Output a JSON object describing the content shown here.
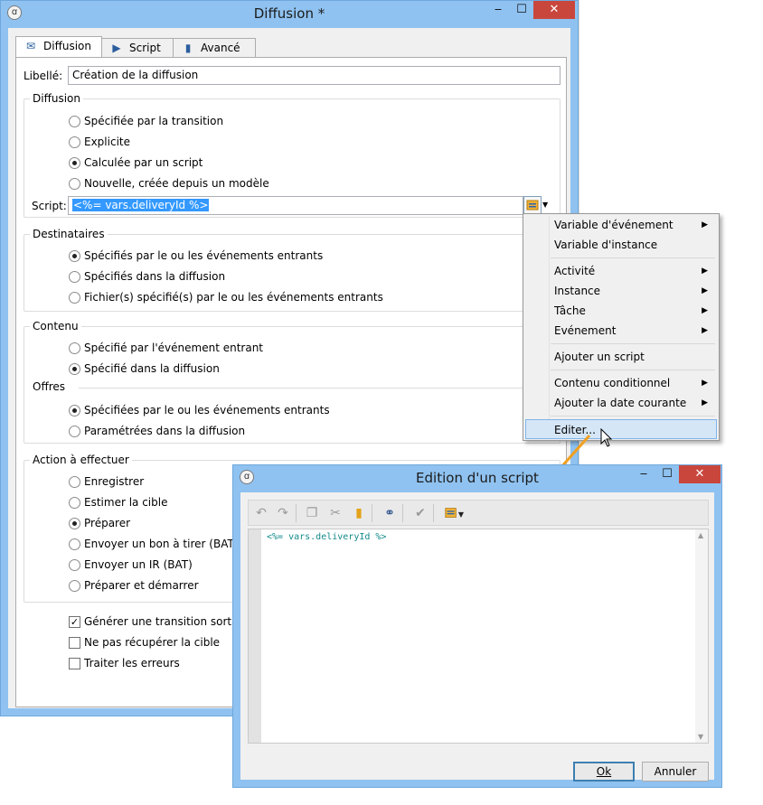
{
  "main_window": {
    "title": "Diffusion *",
    "tabs": [
      {
        "label": "Diffusion",
        "icon": "envelope-icon"
      },
      {
        "label": "Script",
        "icon": "terminal-icon"
      },
      {
        "label": "Avancé",
        "icon": "clipboard-icon"
      }
    ],
    "libelle_label": "Libellé:",
    "libelle_value": "Création de la diffusion",
    "diffusion_group": {
      "title": "Diffusion",
      "options": [
        {
          "label": "Spécifiée par la transition",
          "checked": false
        },
        {
          "label": "Explicite",
          "checked": false
        },
        {
          "label": "Calculée par un script",
          "checked": true
        },
        {
          "label": "Nouvelle, créée depuis un modèle",
          "checked": false
        }
      ],
      "script_label": "Script:",
      "script_value": "<%= vars.deliveryId %>"
    },
    "destinataires_group": {
      "title": "Destinataires",
      "options": [
        {
          "label": "Spécifiés par le ou les événements entrants",
          "checked": true
        },
        {
          "label": "Spécifiés dans la diffusion",
          "checked": false
        },
        {
          "label": "Fichier(s) spécifié(s) par le ou les événements entrants",
          "checked": false
        }
      ]
    },
    "contenu_group": {
      "title": "Contenu",
      "options": [
        {
          "label": "Spécifié par l'événement entrant",
          "checked": false
        },
        {
          "label": "Spécifié dans la diffusion",
          "checked": true
        }
      ]
    },
    "offres_group": {
      "title": "Offres",
      "options": [
        {
          "label": "Spécifiées par le ou les événements entrants",
          "checked": true
        },
        {
          "label": "Paramétrées dans la diffusion",
          "checked": false
        }
      ]
    },
    "action_group": {
      "title": "Action à effectuer",
      "options": [
        {
          "label": "Enregistrer",
          "checked": false
        },
        {
          "label": "Estimer la cible",
          "checked": false
        },
        {
          "label": "Préparer",
          "checked": true
        },
        {
          "label": "Envoyer un bon à tirer (BAT)",
          "checked": false
        },
        {
          "label": "Envoyer un IR (BAT)",
          "checked": false
        },
        {
          "label": "Préparer et démarrer",
          "checked": false
        }
      ]
    },
    "checkboxes": [
      {
        "label": "Générer une transition sortante",
        "checked": true
      },
      {
        "label": "Ne pas récupérer la cible",
        "checked": false
      },
      {
        "label": "Traiter les erreurs",
        "checked": false
      }
    ]
  },
  "context_menu": {
    "items": [
      {
        "label": "Variable d'événement",
        "submenu": true
      },
      {
        "label": "Variable d'instance",
        "submenu": false
      },
      {
        "label": "Activité",
        "submenu": true
      },
      {
        "label": "Instance",
        "submenu": true
      },
      {
        "label": "Tâche",
        "submenu": true
      },
      {
        "label": "Evénement",
        "submenu": true
      },
      {
        "label": "Ajouter un script",
        "submenu": false
      },
      {
        "label": "Contenu conditionnel",
        "submenu": true
      },
      {
        "label": "Ajouter la date courante",
        "submenu": true
      },
      {
        "label": "Editer...",
        "submenu": false,
        "highlighted": true
      }
    ],
    "submenu_arrow": "▶"
  },
  "script_dialog": {
    "title": "Edition d'un script",
    "code": "<%= vars.deliveryId %>",
    "ok_label": "Ok",
    "cancel_label": "Annuler"
  },
  "colors": {
    "titlebar": "#8fc2f0",
    "close_button": "#c9463d",
    "selection": "#3399ff",
    "callout_arrow": "#f0a020",
    "code_text": "#138a8a"
  }
}
